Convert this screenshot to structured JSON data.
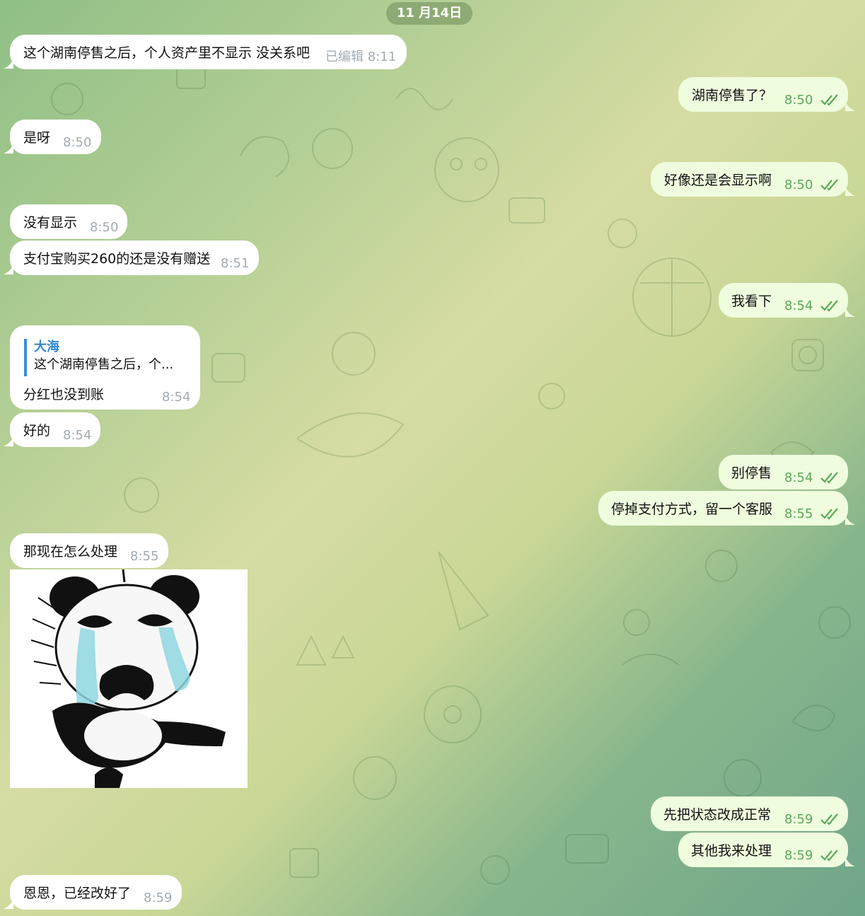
{
  "date_label": "11 月14日",
  "messages": [
    {
      "text": "这个湖南停售之后，个人资产里不显示  没关系吧",
      "time": "已编辑 8:11"
    },
    {
      "text": "湖南停售了？",
      "time": "8:50"
    },
    {
      "text": "是呀",
      "time": "8:50"
    },
    {
      "text": "好像还是会显示啊",
      "time": "8:50"
    },
    {
      "text": "没有显示",
      "time": "8:50"
    },
    {
      "text": "支付宝购买260的还是没有赠送",
      "time": "8:51"
    },
    {
      "text": "我看下",
      "time": "8:54"
    },
    {
      "text": "分红也没到账",
      "time": "8:54",
      "reply_author": "大海",
      "reply_snippet": "这个湖南停售之后，个..."
    },
    {
      "text": "好的",
      "time": "8:54"
    },
    {
      "text": "别停售",
      "time": "8:54"
    },
    {
      "text": "停掉支付方式，留一个客服",
      "time": "8:55"
    },
    {
      "text": "那现在怎么处理",
      "time": "8:55"
    },
    {
      "text": "先把状态改成正常",
      "time": "8:59"
    },
    {
      "text": "其他我来处理",
      "time": "8:59"
    },
    {
      "text": "恩恩，已经改好了",
      "time": "8:59"
    }
  ],
  "colors": {
    "incoming_bubble": "#ffffff",
    "outgoing_bubble": "#effdde",
    "outgoing_time": "#5aa85a",
    "read_check": "#5aa85a",
    "reply_accent": "#2e87cc"
  },
  "icons": {
    "read_receipt": "double-check-icon",
    "sticker": "crying-panda-sticker"
  }
}
